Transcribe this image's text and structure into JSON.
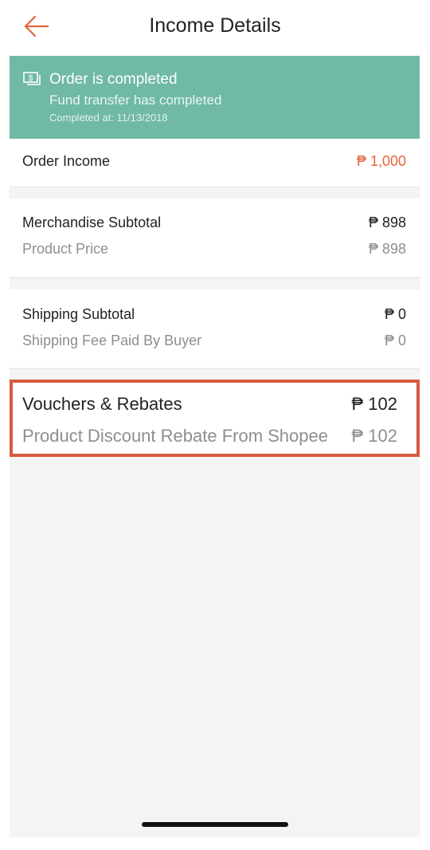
{
  "header": {
    "title": "Income Details",
    "back_icon": "arrow-left-icon",
    "accent_color": "#e2643f"
  },
  "status": {
    "icon": "money-icon",
    "title": "Order is completed",
    "subtitle": "Fund transfer has completed",
    "completed_at": "Completed at: 11/13/2018",
    "color": "#70b9a6"
  },
  "order_income": {
    "label": "Order Income",
    "amount": "₱ 1,000"
  },
  "merchandise": {
    "label": "Merchandise Subtotal",
    "amount": "₱ 898",
    "items": [
      {
        "label": "Product Price",
        "amount": "₱ 898"
      }
    ]
  },
  "shipping": {
    "label": "Shipping Subtotal",
    "amount": "₱ 0",
    "items": [
      {
        "label": "Shipping Fee Paid By Buyer",
        "amount": "₱ 0"
      }
    ]
  },
  "vouchers": {
    "label": "Vouchers & Rebates",
    "amount": "₱ 102",
    "items": [
      {
        "label": "Product Discount Rebate From Shopee",
        "amount": "₱ 102"
      }
    ],
    "highlight_color": "#d9593d"
  }
}
